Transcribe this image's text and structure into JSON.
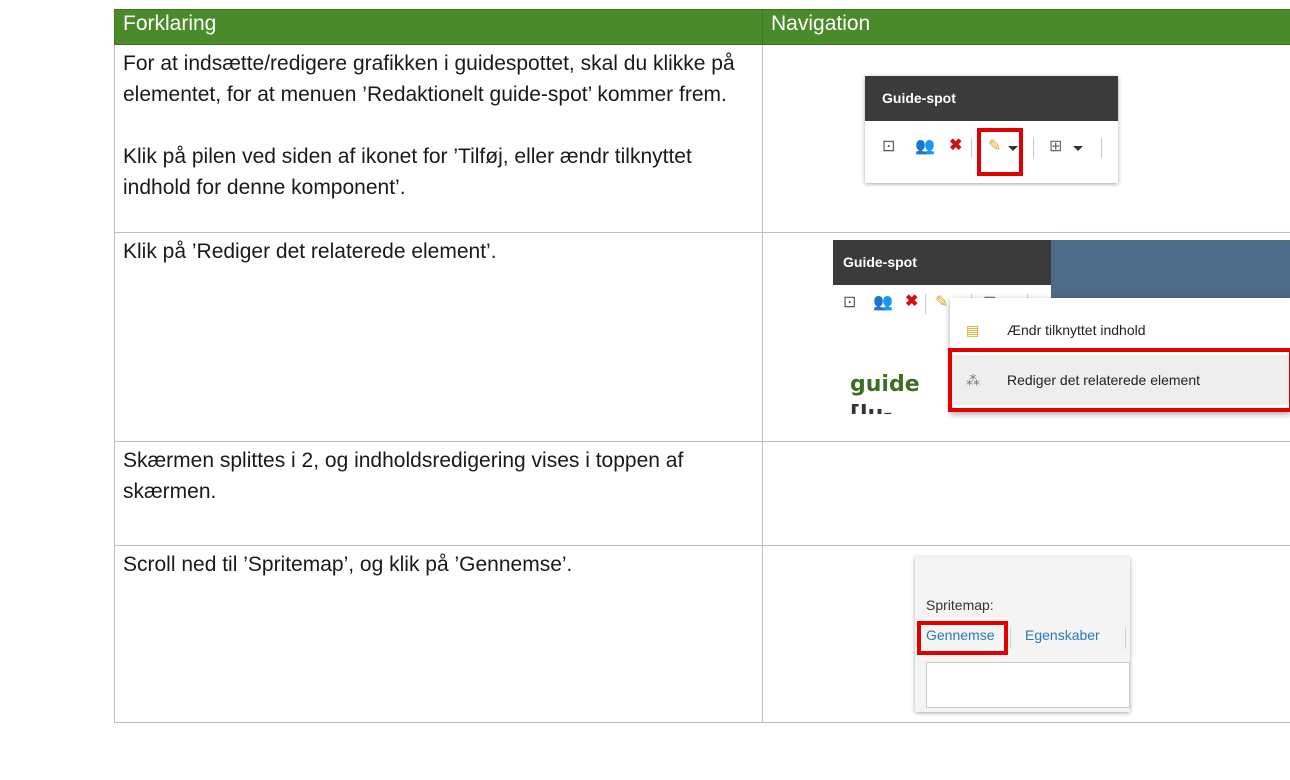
{
  "header": {
    "col1": "Forklaring",
    "col2": "Navigation"
  },
  "rows": [
    {
      "para1": "For at indsætte/redigere grafikken i guidespottet, skal du klikke på elementet, for at menuen ’Redaktionelt guide-spot’ kommer frem.",
      "para2": "Klik på pilen ved siden af ikonet for ’Tilføj, eller ændr tilknyttet indhold for denne komponent’."
    },
    {
      "para1": "Klik på ’Rediger det relaterede element’."
    },
    {
      "para1": "Skærmen splittes i 2, og indholdsredigering vises i toppen af skærmen."
    },
    {
      "para1": "Scroll ned til ’Spritemap’, og klik på ’Gennemse’."
    }
  ],
  "shot1": {
    "title": "Guide-spot"
  },
  "shot2": {
    "title": "Guide-spot",
    "bg_text": "guide",
    "bg_text2": "[lu-",
    "menu": [
      {
        "label": "Ændr tilknyttet indhold",
        "icon": "document-icon"
      },
      {
        "label": "Rediger det relaterede element",
        "icon": "relations-icon"
      }
    ]
  },
  "shot4": {
    "label": "Spritemap:",
    "browse": "Gennemse",
    "properties": "Egenskaber"
  },
  "colors": {
    "header_bg": "#4a8a2a",
    "highlight": "#e00000",
    "toolbar_bg": "#3b3b3b",
    "link": "#2a7ab8"
  }
}
